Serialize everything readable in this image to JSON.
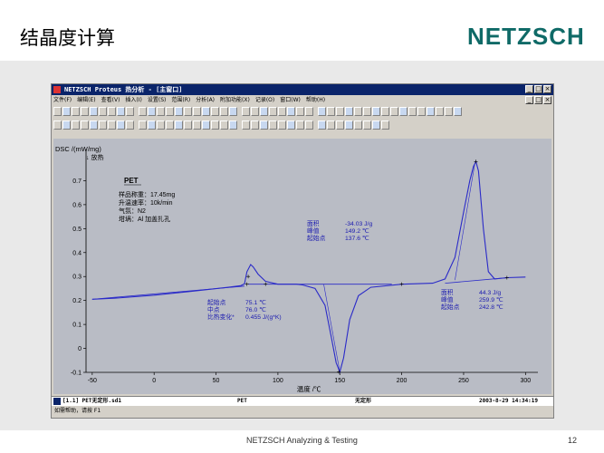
{
  "slide": {
    "title": "结晶度计算",
    "logo": "NETZSCH",
    "footer_center": "NETZSCH Analyzing & Testing",
    "page_number": "12"
  },
  "window": {
    "title": "NETZSCH Proteus 热分析 - [主窗口]",
    "buttons": [
      "_",
      "□",
      "×"
    ],
    "menus": [
      "文件(F)",
      "编辑(E)",
      "查看(V)",
      "插入(I)",
      "设置(S)",
      "范围(R)",
      "分析(A)",
      "附加功能(X)",
      "记录(O)",
      "窗口(W)",
      "帮助(H)"
    ],
    "menu_right_buttons": [
      "_",
      "□",
      "×"
    ],
    "status": {
      "file": "[1.1] PET无定形.sd1",
      "sample": "PET",
      "state": "无定形",
      "datetime": "2003-8-29  14:34:19"
    },
    "hint": "如需帮助，请按 F1"
  },
  "chart_data": {
    "type": "line",
    "ylabel": "DSC /(mW/mg)",
    "ylabel_sub": "↓ 放热",
    "xlabel": "温度 /℃",
    "xlim": [
      -55,
      310
    ],
    "ylim": [
      -0.1,
      0.8
    ],
    "xticks": [
      -50,
      0,
      50,
      100,
      150,
      200,
      250,
      300
    ],
    "yticks": [
      -0.1,
      0,
      0.1,
      0.2,
      0.3,
      0.4,
      0.5,
      0.6,
      0.7
    ],
    "grid": false,
    "series": [
      {
        "color": "#2a2ac8",
        "x": [
          -50,
          -30,
          0,
          30,
          60,
          70,
          73,
          75,
          78,
          80,
          84,
          90,
          100,
          115,
          120,
          130,
          138,
          143,
          147,
          150,
          153,
          158,
          165,
          175,
          200,
          225,
          235,
          243,
          250,
          255,
          258,
          260,
          262,
          266,
          270,
          275,
          285,
          300
        ],
        "y": [
          0.205,
          0.21,
          0.222,
          0.238,
          0.255,
          0.262,
          0.27,
          0.32,
          0.35,
          0.34,
          0.31,
          0.28,
          0.268,
          0.268,
          0.265,
          0.25,
          0.18,
          0.05,
          -0.06,
          -0.098,
          -0.04,
          0.12,
          0.22,
          0.255,
          0.268,
          0.272,
          0.29,
          0.38,
          0.57,
          0.7,
          0.76,
          0.78,
          0.74,
          0.5,
          0.32,
          0.29,
          0.295,
          0.298
        ]
      }
    ],
    "sample_info": {
      "name": "PET",
      "lines": [
        "样品称重：17.45mg",
        "升温速率：10k/min",
        "气氛：N2",
        "坩埚：Al 加盖扎孔"
      ]
    },
    "annotations": [
      {
        "labels": [
          "起始点",
          "中点",
          "比热变化*"
        ],
        "values": [
          "75.1 ℃",
          "76.0 ℃",
          "0.455 J/(g*K)"
        ]
      },
      {
        "labels": [
          "面积",
          "峰值",
          "起始点"
        ],
        "values": [
          "-34.03 J/g",
          "149.2 ℃",
          "137.6 ℃"
        ]
      },
      {
        "labels": [
          "面积",
          "峰值",
          "起始点"
        ],
        "values": [
          "44.3 J/g",
          "259.9 ℃",
          "242.8 ℃"
        ]
      }
    ]
  }
}
